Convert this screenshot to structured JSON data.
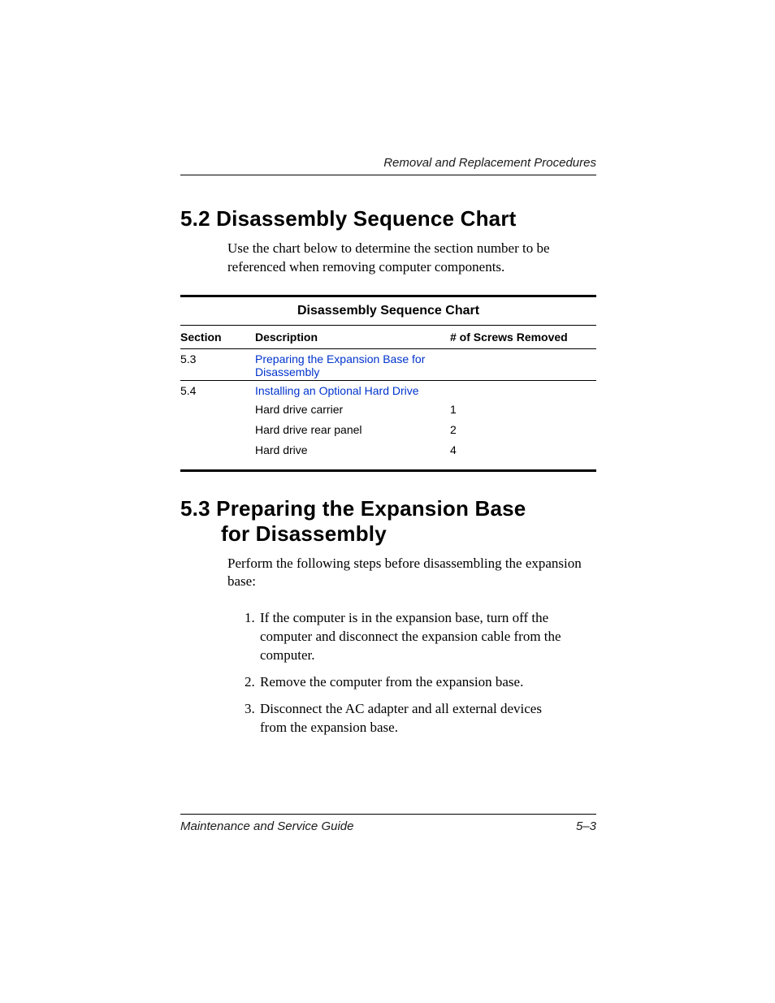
{
  "header": {
    "running_title": "Removal and Replacement Procedures"
  },
  "section_52": {
    "heading": "5.2 Disassembly Sequence Chart",
    "intro": "Use the chart below to determine the section number to be referenced when removing computer components."
  },
  "table": {
    "title": "Disassembly Sequence Chart",
    "cols": {
      "section": "Section",
      "description": "Description",
      "screws": "# of Screws Removed"
    },
    "rows": {
      "r0": {
        "section": "5.3",
        "desc_link": "Preparing the Expansion Base for Disassembly"
      },
      "r1": {
        "section": "5.4",
        "desc_link": "Installing an Optional Hard Drive",
        "sub": {
          "s0": {
            "label": "Hard drive carrier",
            "screws": "1"
          },
          "s1": {
            "label": "Hard drive rear panel",
            "screws": "2"
          },
          "s2": {
            "label": "Hard drive",
            "screws": "4"
          }
        }
      }
    }
  },
  "section_53": {
    "heading_line1": "5.3 Preparing the Expansion Base",
    "heading_line2": "for Disassembly",
    "intro": "Perform the following steps before disassembling the expansion base:",
    "steps": {
      "s1": "If the computer is in the expansion base, turn off the computer and disconnect the expansion cable from the computer.",
      "s2": "Remove the computer from the expansion base.",
      "s3": "Disconnect the AC adapter and all external devices from the expansion base."
    }
  },
  "footer": {
    "left": "Maintenance and Service Guide",
    "right": "5–3"
  }
}
